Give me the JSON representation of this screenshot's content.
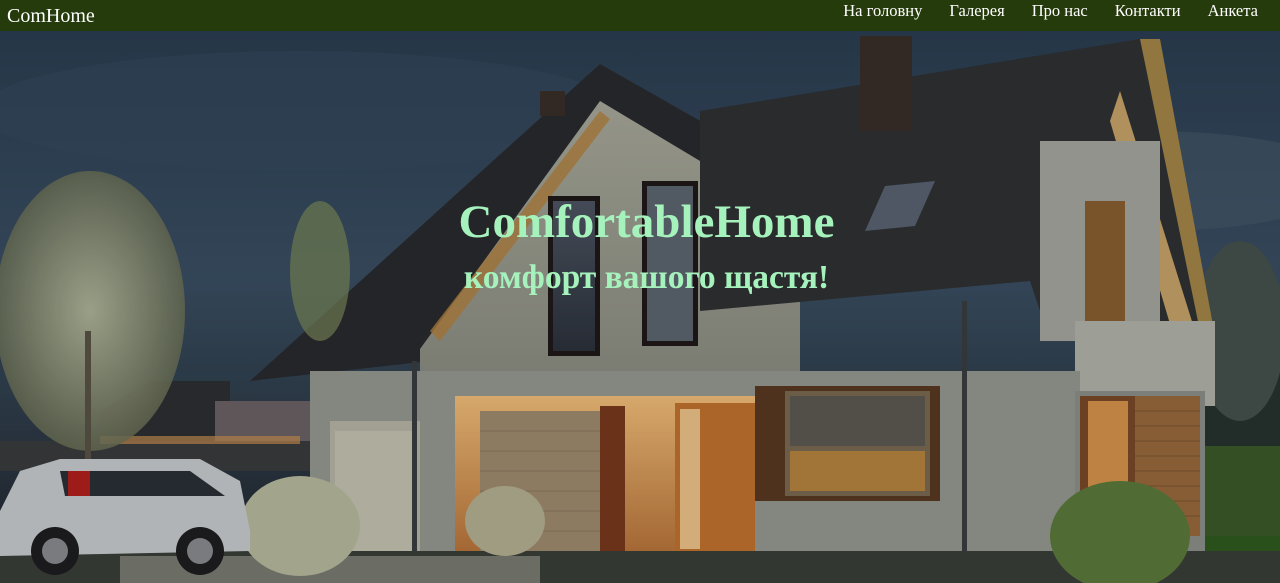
{
  "header": {
    "logo": "ComHome",
    "nav": [
      {
        "label": "На головну"
      },
      {
        "label": "Галерея"
      },
      {
        "label": "Про нас"
      },
      {
        "label": "Контакти"
      },
      {
        "label": "Анкета"
      }
    ]
  },
  "hero": {
    "title": "ComfortableHome",
    "subtitle": "комфорт вашого щастя!"
  },
  "colors": {
    "header_bg": "#263b0b",
    "title_color": "#a6f2bd"
  }
}
